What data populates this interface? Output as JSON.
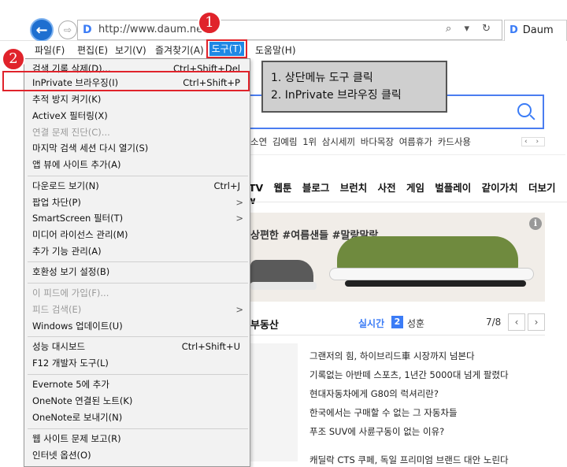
{
  "browser": {
    "url": "http://www.daum.net/",
    "tab_title": "Daum",
    "favicon_letter": "D",
    "url_icons": "⌕ ▾ ↻"
  },
  "menubar": {
    "items": [
      "파일(F)",
      "편집(E)",
      "보기(V)",
      "즐겨찾기(A)",
      "도구(T)",
      "도움말(H)"
    ]
  },
  "dropdown": {
    "items": [
      {
        "label": "검색 기록 삭제(D)...",
        "shortcut": "Ctrl+Shift+Del",
        "disabled": false
      },
      {
        "label": "InPrivate 브라우징(I)",
        "shortcut": "Ctrl+Shift+P",
        "disabled": false
      },
      {
        "label": "추적 방지 켜기(K)",
        "shortcut": "",
        "disabled": false
      },
      {
        "label": "ActiveX 필터링(X)",
        "shortcut": "",
        "disabled": false
      },
      {
        "label": "연결 문제 진단(C)...",
        "shortcut": "",
        "disabled": true
      },
      {
        "label": "마지막 검색 세션 다시 열기(S)",
        "shortcut": "",
        "disabled": false
      },
      {
        "label": "앱 뷰에 사이트 추가(A)",
        "shortcut": "",
        "disabled": false
      },
      {
        "label": "다운로드 보기(N)",
        "shortcut": "Ctrl+J",
        "disabled": false
      },
      {
        "label": "팝업 차단(P)",
        "shortcut": ">",
        "disabled": false
      },
      {
        "label": "SmartScreen 필터(T)",
        "shortcut": ">",
        "disabled": false
      },
      {
        "label": "미디어 라이선스 관리(M)",
        "shortcut": "",
        "disabled": false
      },
      {
        "label": "추가 기능 관리(A)",
        "shortcut": "",
        "disabled": false
      },
      {
        "label": "호환성 보기 설정(B)",
        "shortcut": "",
        "disabled": false
      },
      {
        "label": "이 피드에 가입(F)...",
        "shortcut": "",
        "disabled": true
      },
      {
        "label": "피드 검색(E)",
        "shortcut": ">",
        "disabled": true
      },
      {
        "label": "Windows 업데이트(U)",
        "shortcut": "",
        "disabled": false
      },
      {
        "label": "성능 대시보드",
        "shortcut": "Ctrl+Shift+U",
        "disabled": false
      },
      {
        "label": "F12 개발자 도구(L)",
        "shortcut": "",
        "disabled": false
      },
      {
        "label": "Evernote 5에 추가",
        "shortcut": "",
        "disabled": false
      },
      {
        "label": "OneNote 연결된 노트(K)",
        "shortcut": "",
        "disabled": false
      },
      {
        "label": "OneNote로 보내기(N)",
        "shortcut": "",
        "disabled": false
      },
      {
        "label": "웹 사이트 문제 보고(R)",
        "shortcut": "",
        "disabled": false
      },
      {
        "label": "인터넷 옵션(O)",
        "shortcut": "",
        "disabled": false
      }
    ]
  },
  "callouts": {
    "badge1": "1",
    "badge2": "2",
    "note_line1": "1. 상단메뉴 도구 클릭",
    "note_line2": "2. InPrivate 브라우징 클릭"
  },
  "page": {
    "trending": "소연  김예림 1위  삼시세끼 바다목장  여름휴가 카드사용",
    "trend_nav": "‹ ›",
    "nav": "TV 웹툰 블로그 브런치 사전 게임 벌플레이 같이가치 더보기 ∨",
    "banner_text": "상편한 #여름샌들 #말랑말랑",
    "info": "i",
    "section_title": "부동산",
    "live_label": "실시간",
    "live_rank": "2",
    "live_word": "성훈",
    "pager": "7/8",
    "prev": "‹",
    "next": "›",
    "news": [
      "그랜저의 힘, 하이브리드車 시장까지 넘본다",
      "기록없는 아반떼 스포츠, 1년간 5000대 넘게 팔렸다",
      "현대자동차에게 G80의 럭셔리란?",
      "한국에서는 구매할 수 없는 그 자동차들",
      "푸조 SUV에 사륜구동이 없는 이유?",
      "캐딜락 CTS 쿠페, 독일 프리미엄 브랜드 대안 노린다"
    ]
  },
  "colors": {
    "accent": "#1e88e5",
    "highlight_border": "#e0232b",
    "note_bg": "#cfcfcf"
  }
}
